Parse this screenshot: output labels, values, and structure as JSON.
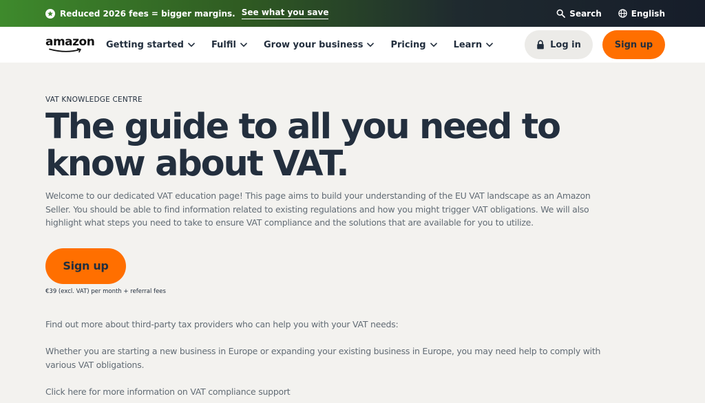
{
  "promo": {
    "text": "Reduced 2026 fees = bigger margins.",
    "link": "See what you save",
    "search_label": "Search",
    "language_label": "English"
  },
  "nav": {
    "logo_text": "amazon",
    "items": [
      {
        "label": "Getting started"
      },
      {
        "label": "Fulfil"
      },
      {
        "label": "Grow your business"
      },
      {
        "label": "Pricing"
      },
      {
        "label": "Learn"
      }
    ],
    "login_label": "Log in",
    "signup_label": "Sign up"
  },
  "hero": {
    "eyebrow": "VAT KNOWLEDGE CENTRE",
    "headline": "The guide to all you need to know about VAT.",
    "intro": "Welcome to our dedicated VAT education page! This page aims to build your understanding of the EU VAT landscape as an Amazon Seller. You should be able to find information related to existing regulations and how you might trigger VAT obligations. We will also highlight what steps you need to take to ensure VAT compliance and the solutions that are available for you to utilize.",
    "cta_label": "Sign up",
    "price_note": "€39 (excl. VAT) per month + referral fees"
  },
  "body": {
    "p1": "Find out more about third-party tax providers who can help you with your VAT needs:",
    "p2": "Whether you are starting a new business in Europe or expanding your existing business in Europe, you may need help to comply with various VAT obligations.",
    "p3": "Click here for more information on VAT compliance support"
  },
  "colors": {
    "brand_orange": "#ff6f00",
    "ink": "#232f3e",
    "background": "#f3f2ef"
  }
}
